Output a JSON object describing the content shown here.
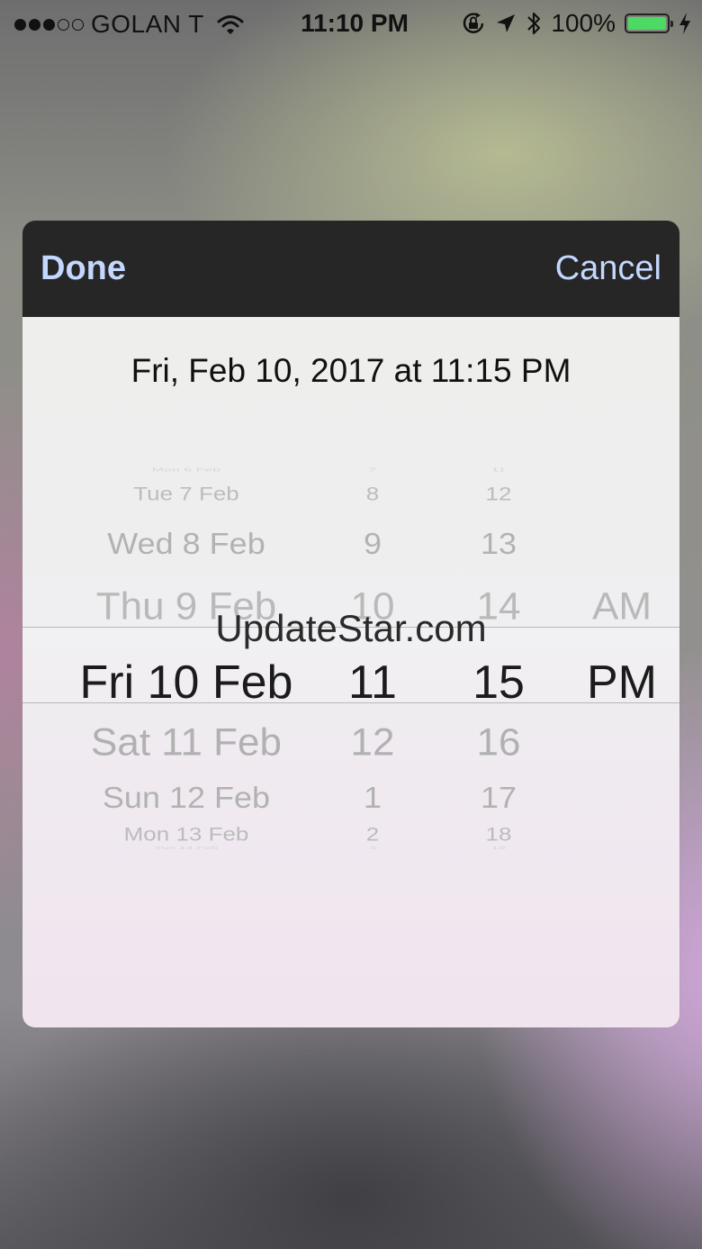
{
  "status_bar": {
    "carrier": "GOLAN T",
    "time": "11:10 PM",
    "battery_percent": "100%",
    "signal_full_dots": 3,
    "signal_empty_dots": 2,
    "battery_level": 1.0,
    "battery_color": "#4cd964",
    "icons": [
      "wifi-icon",
      "rotation-lock-icon",
      "location-arrow-icon",
      "bluetooth-icon",
      "battery-icon",
      "charging-bolt-icon"
    ]
  },
  "toolbar": {
    "done_label": "Done",
    "cancel_label": "Cancel",
    "accent_color": "#c4d8ff"
  },
  "selected_summary": "Fri, Feb 10, 2017 at 11:15 PM",
  "picker": {
    "days": [
      "Mon 6 Feb",
      "Tue 7 Feb",
      "Wed 8 Feb",
      "Thu 9 Feb",
      "Fri 10 Feb",
      "Sat 11 Feb",
      "Sun 12 Feb",
      "Mon 13 Feb",
      "Tue 14 Feb"
    ],
    "hours": [
      "7",
      "8",
      "9",
      "10",
      "11",
      "12",
      "1",
      "2",
      "3"
    ],
    "minutes": [
      "11",
      "12",
      "13",
      "14",
      "15",
      "16",
      "17",
      "18",
      "19"
    ],
    "periods": [
      "AM",
      "PM"
    ],
    "selected": {
      "day": "Fri 10 Feb",
      "hour": "11",
      "minute": "15",
      "period": "PM"
    }
  },
  "watermark": "UpdateStar.com"
}
